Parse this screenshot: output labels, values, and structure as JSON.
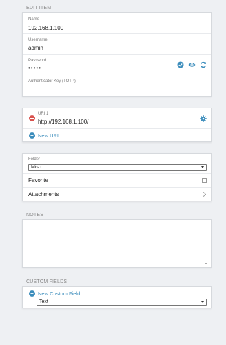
{
  "headers": {
    "edit_item": "EDIT ITEM",
    "notes": "NOTES",
    "custom_fields": "CUSTOM FIELDS"
  },
  "login": {
    "name_label": "Name",
    "name_value": "192.168.1.100",
    "username_label": "Username",
    "username_value": "admin",
    "password_label": "Password",
    "password_value": "•••••",
    "totp_label": "Authenticator Key (TOTP)",
    "totp_value": ""
  },
  "uris": {
    "items": [
      {
        "label": "URI 1",
        "value": "http://192.168.1.100/"
      }
    ],
    "new_uri_label": "New URI"
  },
  "options": {
    "folder_label": "Folder",
    "folder_value": "Misc",
    "favorite_label": "Favorite",
    "favorite_checked": false,
    "attachments_label": "Attachments"
  },
  "notes": {
    "value": ""
  },
  "custom_fields": {
    "new_field_label": "New Custom Field",
    "type_value": "Text"
  },
  "colors": {
    "accent": "#3c8dbc",
    "danger": "#d9534f",
    "background": "#eef0f3"
  }
}
